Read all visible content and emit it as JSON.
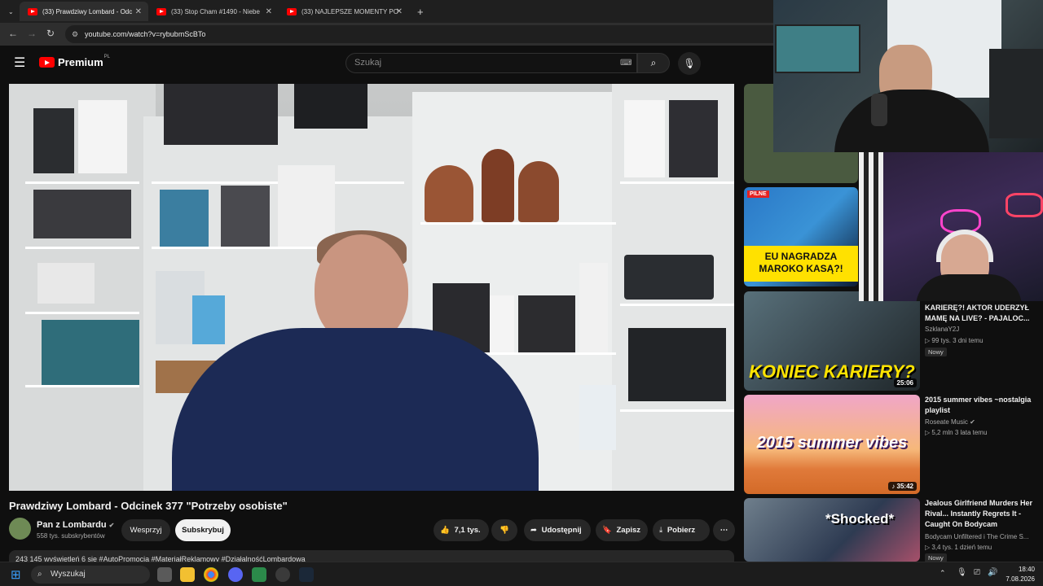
{
  "browser": {
    "tabs": [
      {
        "label": "(33) Prawdziwy Lombard - Odc"
      },
      {
        "label": "(33) Stop Cham #1490 - Niebe"
      },
      {
        "label": "(33) NAJLEPSZE MOMENTY PO"
      }
    ],
    "url": "youtube.com/watch?v=rybubmScBTo"
  },
  "header": {
    "logo_text": "Premium",
    "logo_sup": "PL",
    "search_placeholder": "Szukaj"
  },
  "video": {
    "title": "Prawdziwy Lombard - Odcinek 377 \"Potrzeby osobiste\"",
    "channel": "Pan z Lombardu",
    "subscribers": "558 tys. subskrybentów",
    "support_label": "Wesprzyj",
    "subscribe_label": "Subskrybuj",
    "likes": "7,1 tys.",
    "share_label": "Udostępnij",
    "save_label": "Zapisz",
    "download_label": "Pobierz",
    "description": "243 145 wyświetleń  6 sie  #AutoPromocja #MateriałReklamowy #DziałalnośćLombardowa"
  },
  "sidebar": {
    "items": [
      {
        "title": "KARIERĘ?! AKTOR UDERZYŁ MAMĘ NA LIVE? - PAJALOC...",
        "channel": "SzklanaY2J",
        "meta": "▷ 99 tys.   3 dni temu",
        "badge": "Nowy",
        "duration": "25:06",
        "thumb_text": "KONIEC KARIERY?"
      },
      {
        "title": "2015 summer vibes ~nostalgia playlist",
        "channel": "Roseate Music ✔",
        "meta": "▷ 5,2 mln   3 lata temu",
        "duration": "♪ 35:42",
        "thumb_text": "2015 summer vibes"
      },
      {
        "title": "Jealous Girlfriend Murders Her Rival... Instantly Regrets It - Caught On Bodycam",
        "channel": "Bodycam Unfiltered i The Crime S...",
        "meta": "▷ 3,4 tys.   1 dzień temu",
        "badge": "Nowy",
        "thumb_text": "*Shocked*"
      },
      {
        "thumb_text": "EU NAGRADZA MAROKO KASĄ?!",
        "thumb_tag": "PILNE"
      }
    ]
  },
  "taskbar": {
    "search_label": "Wyszukaj",
    "time": "18:40",
    "date": "7.08.2026"
  }
}
